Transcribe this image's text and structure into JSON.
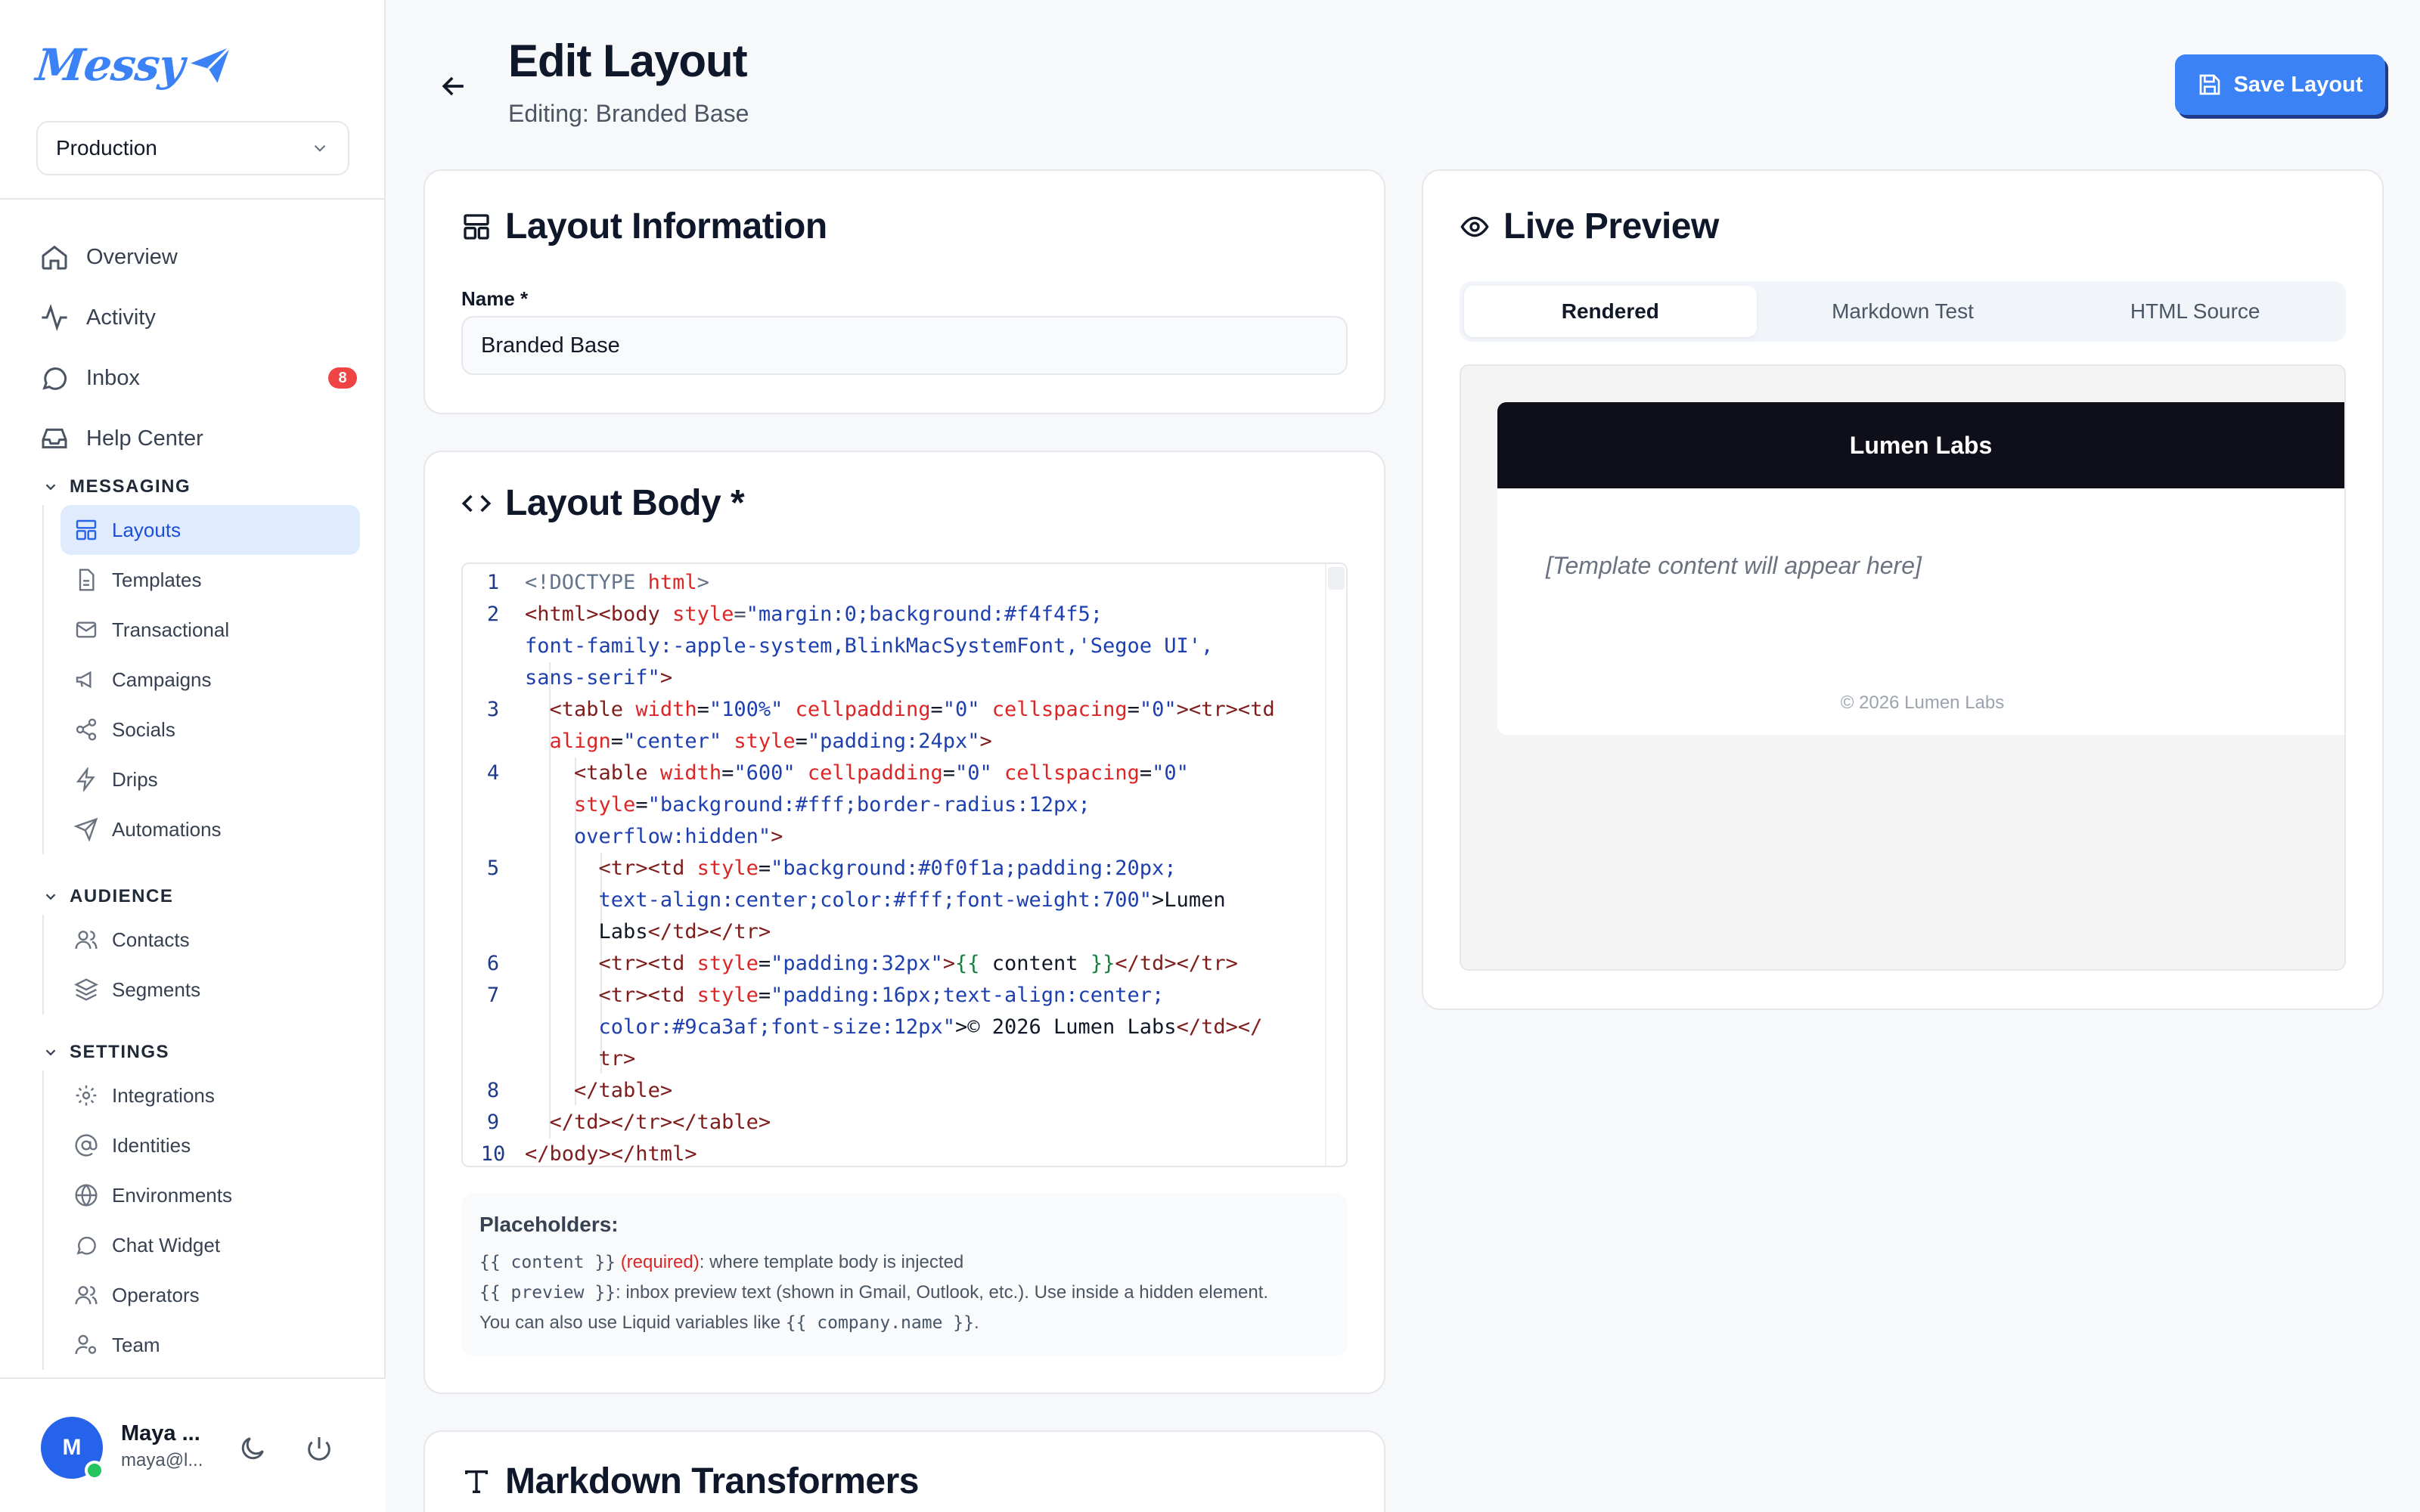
{
  "brand": {
    "name": "Messy",
    "accent": "#3b82f6"
  },
  "environment": {
    "selected": "Production"
  },
  "nav": {
    "top": [
      {
        "label": "Overview",
        "icon": "home-icon"
      },
      {
        "label": "Activity",
        "icon": "activity-icon"
      },
      {
        "label": "Inbox",
        "icon": "chat-icon",
        "badge": "8"
      },
      {
        "label": "Help Center",
        "icon": "inbox-tray-icon"
      }
    ],
    "messaging": {
      "title": "MESSAGING",
      "items": [
        {
          "label": "Layouts",
          "icon": "layout-icon",
          "active": true
        },
        {
          "label": "Templates",
          "icon": "file-icon"
        },
        {
          "label": "Transactional",
          "icon": "mail-icon"
        },
        {
          "label": "Campaigns",
          "icon": "megaphone-icon"
        },
        {
          "label": "Socials",
          "icon": "share-icon"
        },
        {
          "label": "Drips",
          "icon": "bolt-icon"
        },
        {
          "label": "Automations",
          "icon": "send-icon"
        }
      ]
    },
    "audience": {
      "title": "AUDIENCE",
      "items": [
        {
          "label": "Contacts",
          "icon": "users-icon"
        },
        {
          "label": "Segments",
          "icon": "layers-icon"
        }
      ]
    },
    "settings": {
      "title": "SETTINGS",
      "items": [
        {
          "label": "Integrations",
          "icon": "gear-icon"
        },
        {
          "label": "Identities",
          "icon": "at-icon"
        },
        {
          "label": "Environments",
          "icon": "globe-icon"
        },
        {
          "label": "Chat Widget",
          "icon": "chat-icon"
        },
        {
          "label": "Operators",
          "icon": "users-icon"
        },
        {
          "label": "Team",
          "icon": "team-icon"
        }
      ]
    }
  },
  "user": {
    "initial": "M",
    "name": "Maya ...",
    "email": "maya@l..."
  },
  "header": {
    "title": "Edit Layout",
    "subtitle": "Editing: Branded Base",
    "save_label": "Save Layout"
  },
  "layout_info": {
    "title": "Layout Information",
    "name_label": "Name *",
    "name_value": "Branded Base"
  },
  "layout_body": {
    "title": "Layout Body *",
    "line_numbers": [
      "1",
      "2",
      "3",
      "4",
      "5",
      "6",
      "7",
      "8",
      "9",
      "10"
    ],
    "code": {
      "l1_tag": "<!DOCTYPE ",
      "l1_b": "html",
      "l1_c": ">",
      "l2a_tag": "<html><body ",
      "l2a_attr": "style",
      "l2a_eq": "=",
      "l2a_val": "\"margin:0;background:#f4f4f5;",
      "l2b_val": "font-family:-apple-system,BlinkMacSystemFont,'Segoe UI',",
      "l2c_val": "sans-serif\"",
      "l2c_end": ">",
      "l3a_tag": "<table ",
      "l3a_a1": "width",
      "l3a_v1": "\"100%\"",
      "l3a_a2": "cellpadding",
      "l3a_v2": "\"0\"",
      "l3a_a3": "cellspacing",
      "l3a_v3": "\"0\"",
      "l3a_t2": "><tr><td",
      "l3b_a": "align",
      "l3b_v1": "\"center\"",
      "l3b_a2": "style",
      "l3b_v2": "\"padding:24px\"",
      "l3b_end": ">",
      "l4a_tag": "<table ",
      "l4a_a1": "width",
      "l4a_v1": "\"600\"",
      "l4a_a2": "cellpadding",
      "l4a_v2": "\"0\"",
      "l4a_a3": "cellspacing",
      "l4a_v3": "\"0\"",
      "l4b_a": "style",
      "l4b_v": "\"background:#fff;border-radius:12px;",
      "l4c_v": "overflow:hidden\"",
      "l4c_end": ">",
      "l5a_tag": "<tr><td ",
      "l5a_a": "style",
      "l5a_v": "\"background:#0f0f1a;padding:20px;",
      "l5b_v": "text-align:center;color:#fff;font-weight:700\"",
      "l5b_end": ">Lumen",
      "l5c_txt": "Labs",
      "l5c_tag": "</td></tr>",
      "l6_tag": "<tr><td ",
      "l6_a": "style",
      "l6_v": "\"padding:32px\"",
      "l6_gt": ">",
      "l6_liq1": "{{",
      "l6_txt": " content ",
      "l6_liq2": "}}",
      "l6_end": "</td></tr>",
      "l7a_tag": "<tr><td ",
      "l7a_a": "style",
      "l7a_v": "\"padding:16px;text-align:center;",
      "l7b_v": "color:#9ca3af;font-size:12px\"",
      "l7b_txt": ">© 2026 Lumen Labs",
      "l7b_tag": "</td></",
      "l7c_tag": "tr>",
      "l8_tag": "</table>",
      "l9_tag": "</td></tr></table>",
      "l10_tag": "</body></html>"
    },
    "placeholders": {
      "title": "Placeholders:",
      "content_code": "{{ content }}",
      "content_required": "(required)",
      "content_desc": ": where template body is injected",
      "preview_code": "{{ preview }}",
      "preview_desc": ": inbox preview text (shown in Gmail, Outlook, etc.). Use inside a hidden element.",
      "liquid_prefix": "You can also use Liquid variables like ",
      "liquid_code": "{{ company.name }}",
      "liquid_suffix": "."
    }
  },
  "markdown": {
    "title": "Markdown Transformers"
  },
  "preview": {
    "title": "Live Preview",
    "tabs": [
      "Rendered",
      "Markdown Test",
      "HTML Source"
    ],
    "active_tab": "Rendered",
    "email_header": "Lumen Labs",
    "email_body": "[Template content will appear here]",
    "email_footer": "© 2026 Lumen Labs"
  },
  "colors": {
    "accent": "#3b82f6",
    "badge": "#ef4444",
    "email_header_bg": "#0f0f1a",
    "online": "#22c55e"
  }
}
